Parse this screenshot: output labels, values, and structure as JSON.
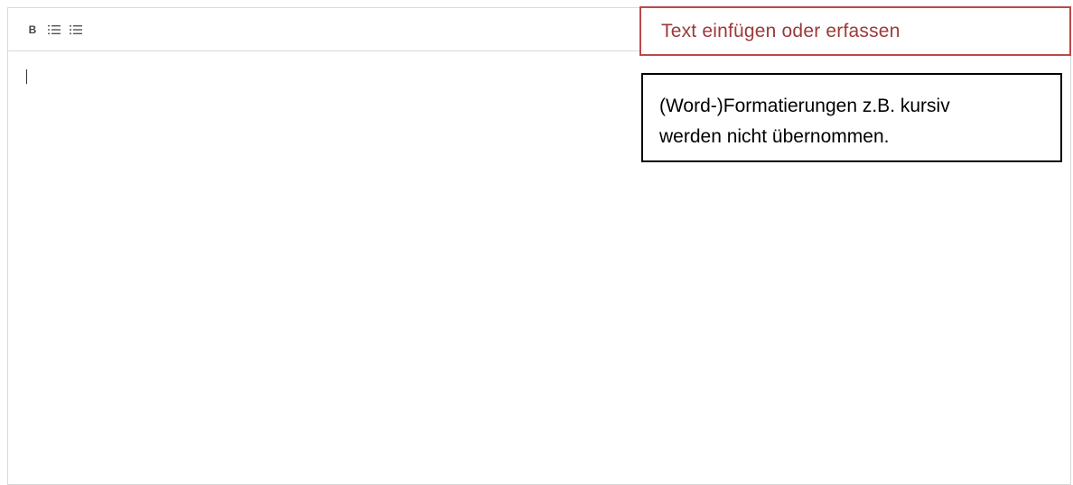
{
  "toolbar": {
    "bold_label": "B",
    "ordered_list_icon": "ordered-list-icon",
    "unordered_list_icon": "unordered-list-icon"
  },
  "editor": {
    "content": ""
  },
  "annotations": {
    "header_callout": "Text einfügen oder erfassen",
    "info_callout_line1": "(Word-)Formatierungen z.B. kursiv",
    "info_callout_line2": "werden nicht übernommen."
  },
  "colors": {
    "callout_red_border": "#b94a48",
    "callout_red_text": "#9b3a38",
    "editor_border": "#d9d9d9"
  }
}
